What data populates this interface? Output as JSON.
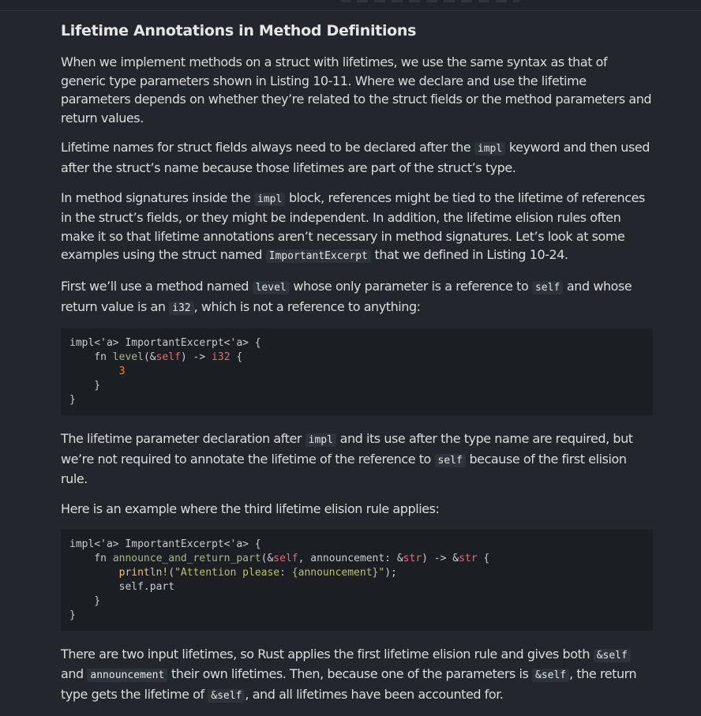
{
  "heading": "Lifetime Annotations in Method Definitions",
  "p1": "When we implement methods on a struct with lifetimes, we use the same syntax as that of generic type parameters shown in Listing 10-11. Where we declare and use the lifetime parameters depends on whether they’re related to the struct fields or the method parameters and return values.",
  "p2": {
    "a": "Lifetime names for struct fields always need to be declared after the ",
    "code": "impl",
    "b": " keyword and then used after the struct’s name because those lifetimes are part of the struct’s type."
  },
  "p3": {
    "a": "In method signatures inside the ",
    "code1": "impl",
    "b": " block, references might be tied to the lifetime of references in the struct’s fields, or they might be independent. In addition, the lifetime elision rules often make it so that lifetime annotations aren’t necessary in method signatures. Let’s look at some examples using the struct named ",
    "code2": "ImportantExcerpt",
    "c": " that we defined in Listing 10-24."
  },
  "p4": {
    "a": "First we’ll use a method named ",
    "code1": "level",
    "b": " whose only parameter is a reference to ",
    "code2": "self",
    "c": " and whose return value is an ",
    "code3": "i32",
    "d": ", which is not a reference to anything:"
  },
  "code1": {
    "l1a": "impl<'a> ImportantExcerpt<'a> {",
    "l2a": "    fn ",
    "l2fn": "level",
    "l2b": "(&",
    "l2self": "self",
    "l2c": ") -> ",
    "l2ty": "i32",
    "l2d": " {",
    "l3": "3",
    "l4": "    }",
    "l5": "}"
  },
  "p5": {
    "a": "The lifetime parameter declaration after ",
    "code1": "impl",
    "b": " and its use after the type name are required, but we’re not required to annotate the lifetime of the reference to ",
    "code2": "self",
    "c": " because of the first elision rule."
  },
  "p6": "Here is an example where the third lifetime elision rule applies:",
  "code2": {
    "l1": "impl<'a> ImportantExcerpt<'a> {",
    "l2a": "    fn ",
    "l2fn": "announce_and_return_part",
    "l2b": "(&",
    "l2self": "self",
    "l2c": ", announcement: &",
    "l2ty1": "str",
    "l2d": ") -> &",
    "l2ty2": "str",
    "l2e": " {",
    "l3mac": "println!",
    "l3a": "(",
    "l3str": "\"Attention please: {announcement}\"",
    "l3b": ");",
    "l4": "self.part",
    "l5": "    }",
    "l6": "}"
  },
  "p7": {
    "a": "There are two input lifetimes, so Rust applies the first lifetime elision rule and gives both ",
    "code1": "&self",
    "b": " and ",
    "code2": "announcement",
    "c": " their own lifetimes. Then, because one of the parameters is ",
    "code3": "&self",
    "d": ", the return type gets the lifetime of ",
    "code4": "&self",
    "e": ", and all lifetimes have been accounted for."
  }
}
